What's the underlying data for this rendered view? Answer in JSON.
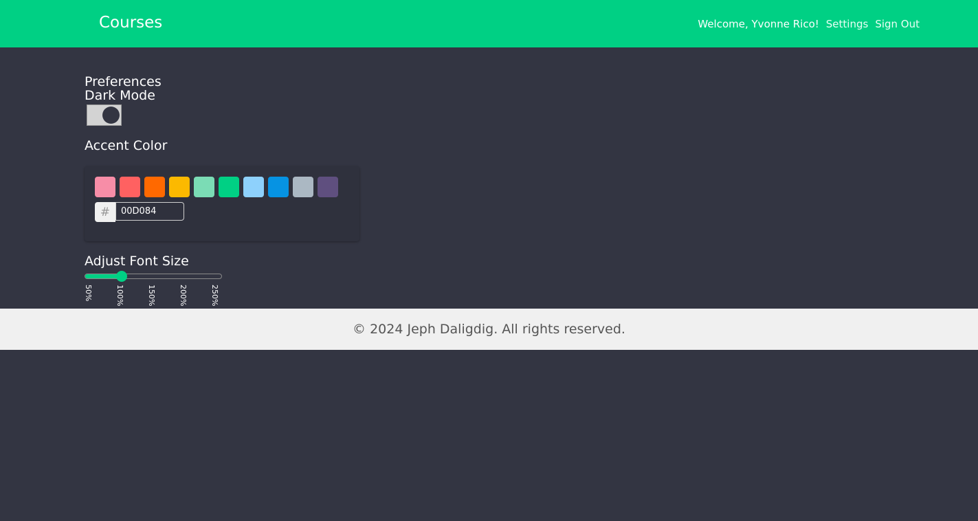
{
  "header": {
    "brand": "Courses",
    "welcome": "Welcome, Yvonne Rico!",
    "settings": "Settings",
    "sign_out": "Sign Out"
  },
  "preferences": {
    "title": "Preferences",
    "dark_mode_label": "Dark Mode",
    "dark_mode_on": true,
    "accent_label": "Accent Color",
    "hash_symbol": "#",
    "hex_value": "00D084",
    "swatches": [
      "#f78da7",
      "#ff6161",
      "#ff6900",
      "#fcb900",
      "#7bdcb5",
      "#00d084",
      "#8ed1fc",
      "#0693e3",
      "#abb8c3",
      "#5f4f7f"
    ],
    "font_size_label": "Adjust Font Size",
    "font_size_ticks": [
      "50%",
      "100%",
      "150%",
      "200%",
      "250%"
    ],
    "font_size_value": "100%"
  },
  "footer": {
    "text": "© 2024 Jeph Daligdig. All rights reserved."
  },
  "colors": {
    "accent": "#00d084",
    "background": "#333542",
    "footer_bg": "#f0f0f0"
  }
}
